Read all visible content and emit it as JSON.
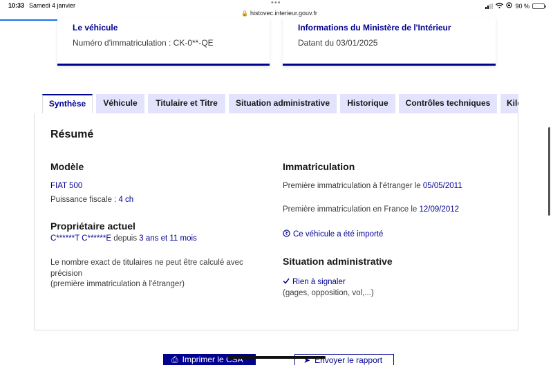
{
  "statusbar": {
    "time": "10:33",
    "date": "Samedi 4 janvier",
    "url": "histovec.interieur.gouv.fr",
    "battery": "90 %",
    "battery_level": 0.9
  },
  "cards": {
    "vehicle": {
      "title": "Le véhicule",
      "text": "Numéro d'immatriculation : CK-0**-QE"
    },
    "ministere": {
      "title": "Informations du Ministère de l'Intérieur",
      "text": "Datant du 03/01/2025"
    }
  },
  "tabs": [
    {
      "label": "Synthèse",
      "active": true
    },
    {
      "label": "Véhicule"
    },
    {
      "label": "Titulaire et Titre"
    },
    {
      "label": "Situation administrative"
    },
    {
      "label": "Historique"
    },
    {
      "label": "Contrôles techniques"
    },
    {
      "label": "Kilo"
    }
  ],
  "summary": {
    "title": "Résumé",
    "modele": {
      "heading": "Modèle",
      "name": "FIAT 500",
      "puissance_label": "Puissance fiscale : ",
      "puissance_value": "4 ch"
    },
    "proprietaire": {
      "heading": "Propriétaire actuel",
      "name": "C******T C******E",
      "depuis_label": " depuis ",
      "depuis_value": "3 ans et 11 mois",
      "note": "Le nombre exact de titulaires ne peut être calculé avec précision",
      "note2": "(première immatriculation à l'étranger)"
    },
    "immatriculation": {
      "heading": "Immatriculation",
      "etranger_label": "Première immatriculation à l'étranger le ",
      "etranger_date": "05/05/2011",
      "france_label": "Première immatriculation en France le ",
      "france_date": "12/09/2012",
      "importe": "Ce véhicule a été importé"
    },
    "situation": {
      "heading": "Situation administrative",
      "status": "Rien à signaler",
      "detail": "(gages, opposition, vol,...)"
    }
  },
  "actions": {
    "print": "Imprimer le CSA",
    "report": "Envoyer le rapport"
  }
}
